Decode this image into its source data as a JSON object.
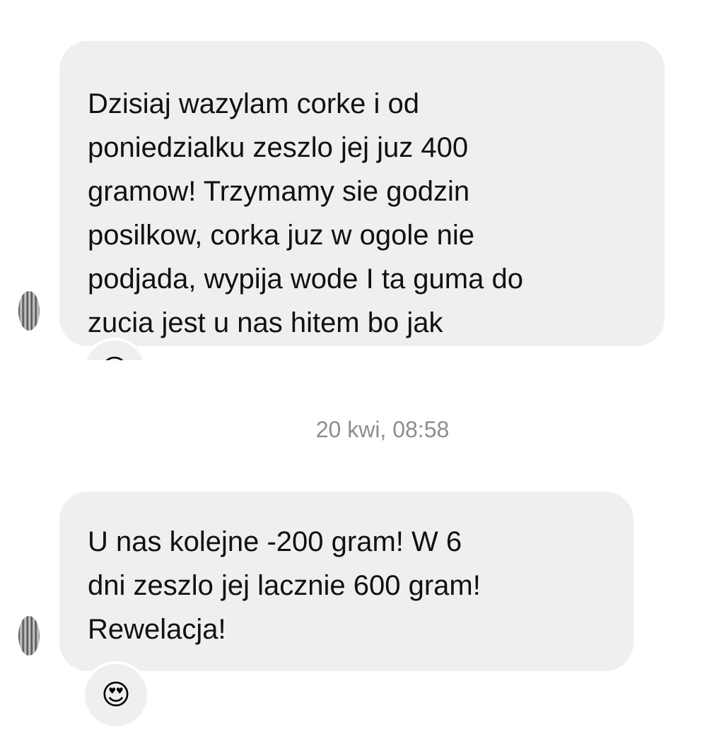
{
  "messages": [
    {
      "lines": [
        "Dzisiaj wazylam corke i od",
        "poniedzialku zeszlo jej juz 400",
        "gramow! Trzymamy sie godzin",
        "posilkow, corka juz w ogole nie",
        "podjada, wypija wode I ta guma do",
        "zucia jest u nas hitem bo jak"
      ],
      "reaction": "😍"
    },
    {
      "lines": [
        "U nas kolejne -200 gram! W 6",
        "dni zeszlo jej lacznie 600 gram!",
        "Rewelacja!"
      ],
      "reaction": "😍"
    }
  ],
  "timestamp": "20 kwi, 08:58"
}
